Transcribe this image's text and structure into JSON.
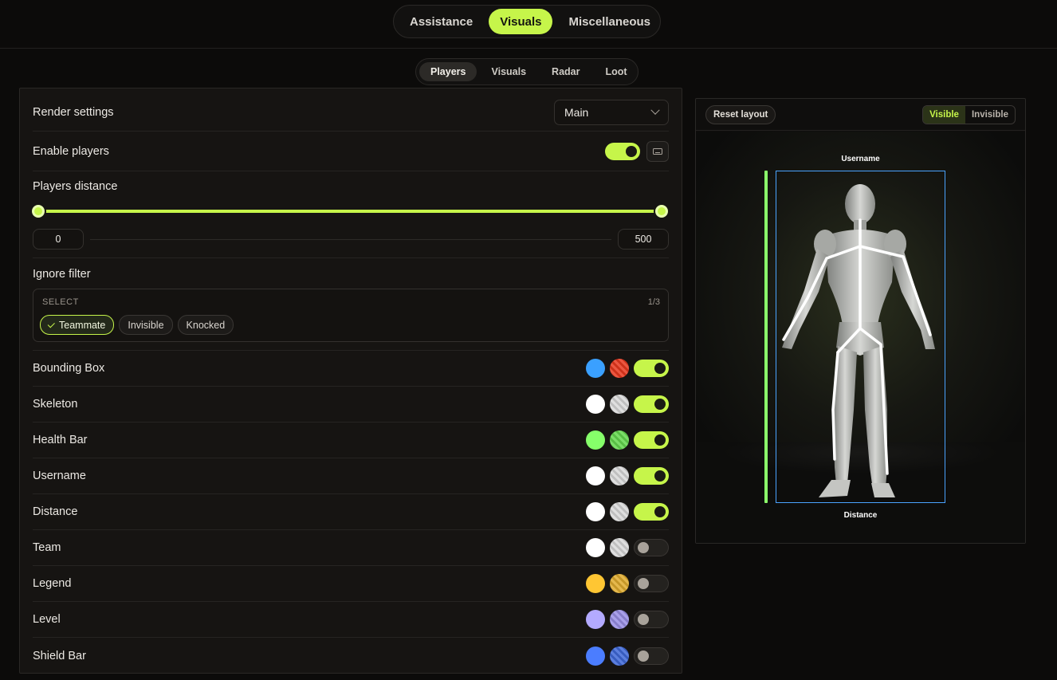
{
  "main_tabs": [
    {
      "label": "Assistance",
      "active": false
    },
    {
      "label": "Visuals",
      "active": true
    },
    {
      "label": "Miscellaneous",
      "active": false
    }
  ],
  "sub_tabs": [
    {
      "label": "Players",
      "active": true
    },
    {
      "label": "Visuals",
      "active": false
    },
    {
      "label": "Radar",
      "active": false
    },
    {
      "label": "Loot",
      "active": false
    }
  ],
  "settings": {
    "render_settings": {
      "label": "Render settings",
      "value": "Main"
    },
    "enable_players": {
      "label": "Enable players",
      "enabled": true
    },
    "players_distance": {
      "label": "Players distance",
      "min": "0",
      "max": "500"
    },
    "ignore_filter": {
      "label": "Ignore filter",
      "select_label": "SELECT",
      "count": "1/3",
      "options": [
        {
          "label": "Teammate",
          "selected": true
        },
        {
          "label": "Invisible",
          "selected": false
        },
        {
          "label": "Knocked",
          "selected": false
        }
      ]
    },
    "features": [
      {
        "label": "Bounding Box",
        "color_visible": "#3aa0ff",
        "color_invisible": "#e8381e",
        "enabled": true
      },
      {
        "label": "Skeleton",
        "color_visible": "#ffffff",
        "color_invisible": "#d9d9d9",
        "enabled": true
      },
      {
        "label": "Health Bar",
        "color_visible": "#86ff6a",
        "color_invisible": "#64d84e",
        "enabled": true
      },
      {
        "label": "Username",
        "color_visible": "#ffffff",
        "color_invisible": "#d9d9d9",
        "enabled": true
      },
      {
        "label": "Distance",
        "color_visible": "#ffffff",
        "color_invisible": "#d9d9d9",
        "enabled": true
      },
      {
        "label": "Team",
        "color_visible": "#ffffff",
        "color_invisible": "#d9d9d9",
        "enabled": false
      },
      {
        "label": "Legend",
        "color_visible": "#ffc633",
        "color_invisible": "#e0ac2e",
        "enabled": false
      },
      {
        "label": "Level",
        "color_visible": "#b3aaff",
        "color_invisible": "#9a90e6",
        "enabled": false
      },
      {
        "label": "Shield Bar",
        "color_visible": "#4b7dff",
        "color_invisible": "#3f69d8",
        "enabled": false
      }
    ]
  },
  "preview": {
    "reset_label": "Reset layout",
    "visible_label": "Visible",
    "invisible_label": "Invisible",
    "username_label": "Username",
    "distance_label": "Distance"
  },
  "colors": {
    "accent": "#c6f54a",
    "box": "#4aa3ff",
    "health": "#8bff6b"
  }
}
